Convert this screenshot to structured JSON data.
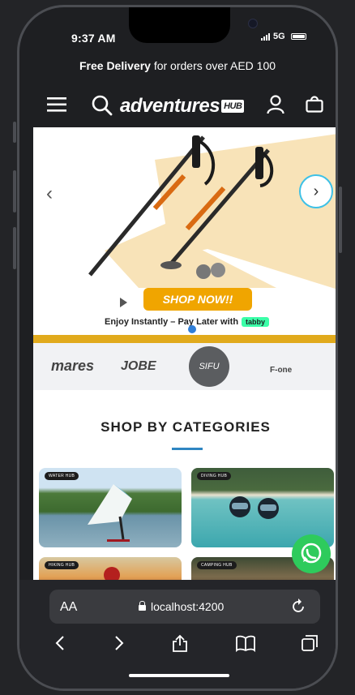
{
  "status_bar": {
    "time": "9:37 AM",
    "network": "5G"
  },
  "promo": {
    "bold": "Free Delivery",
    "rest": " for orders over AED 100"
  },
  "header": {
    "logo_main": "adventures",
    "logo_badge": "HUB"
  },
  "hero": {
    "shop_button": "SHOP NOW!!",
    "pay_later_text": "Enjoy Instantly – Pay Later with",
    "pay_later_brand": "tabby"
  },
  "brands": [
    "mares",
    "JOBE",
    "SIFU",
    "F-one"
  ],
  "categories_title": "SHOP BY CATEGORIES",
  "categories": [
    {
      "badge": "WATER HUB"
    },
    {
      "badge": "DIVING HUB"
    },
    {
      "badge": "HIKING HUB"
    },
    {
      "badge": "CAMPING HUB"
    }
  ],
  "browser": {
    "text_size_label": "AA",
    "url": "localhost:4200"
  },
  "colors": {
    "accent_orange": "#f0a500",
    "whatsapp": "#2ecb5c",
    "tabby": "#3bffa8",
    "link_blue": "#2f86c2"
  }
}
